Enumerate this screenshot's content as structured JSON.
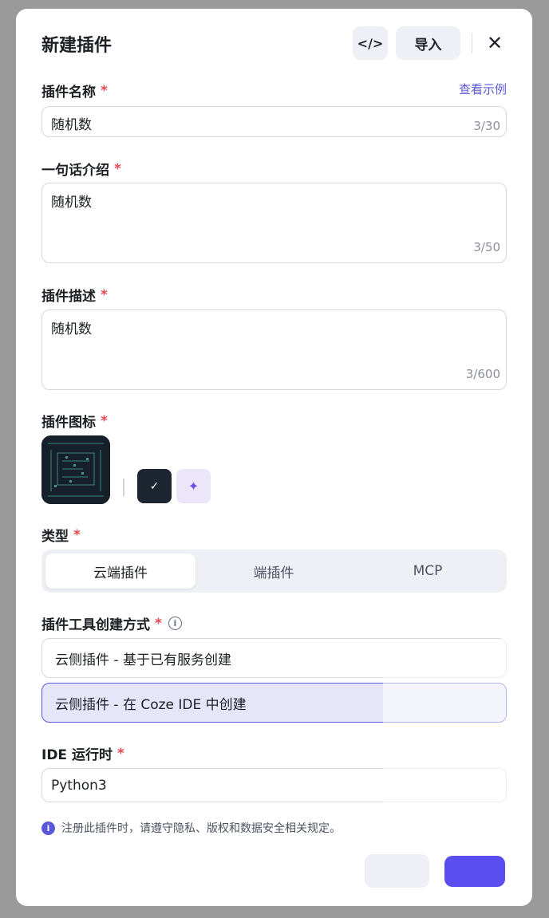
{
  "header": {
    "title": "新建插件",
    "code_icon_glyph": "</>",
    "import_label": "导入",
    "close_glyph": "✕"
  },
  "name_field": {
    "label": "插件名称",
    "required_mark": "*",
    "example_link": "查看示例",
    "value": "随机数",
    "counter": "3/30"
  },
  "intro_field": {
    "label": "一句话介绍",
    "required_mark": "*",
    "value": "随机数",
    "counter": "3/50"
  },
  "desc_field": {
    "label": "插件描述",
    "required_mark": "*",
    "value": "随机数",
    "counter": "3/600"
  },
  "icon_section": {
    "label": "插件图标",
    "required_mark": "*",
    "check_glyph": "✓",
    "ai_glyph": "✦",
    "icon_names": [
      "plugin-avatar-image",
      "check-icon",
      "sparkle-icon"
    ]
  },
  "type_section": {
    "label": "类型",
    "required_mark": "*",
    "options": [
      "云端插件",
      "端插件",
      "MCP"
    ],
    "selected": "云端插件"
  },
  "tool_method": {
    "label": "插件工具创建方式",
    "required_mark": "*",
    "info_glyph": "i",
    "options": [
      "云侧插件 - 基于已有服务创建",
      "云侧插件 - 在 Coze IDE 中创建"
    ],
    "selected": "云侧插件 - 在 Coze IDE 中创建"
  },
  "runtime": {
    "label": "IDE 运行时",
    "required_mark": "*",
    "value": "Python3"
  },
  "notice": {
    "icon_glyph": "i",
    "text": "注册此插件时，请遵守隐私、版权和数据安全相关规定。"
  },
  "footer": {
    "cancel_label": "",
    "confirm_label": ""
  },
  "colors": {
    "accent": "#5b57d9",
    "primary_button": "#5b4ef0",
    "required": "#e5484d",
    "selected_bg": "#e6e6fb"
  }
}
